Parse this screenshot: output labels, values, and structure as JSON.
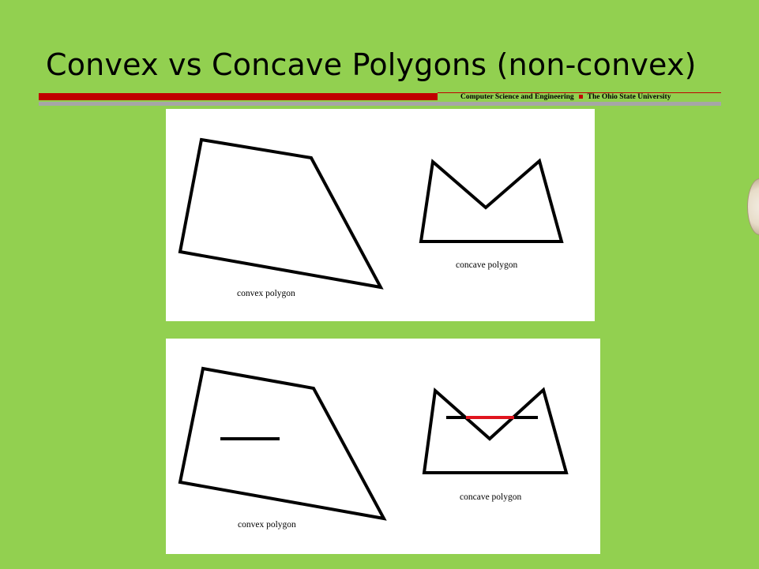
{
  "slide": {
    "title": "Convex vs Concave Polygons (non-convex)",
    "footer": {
      "department": "Computer Science and Engineering",
      "university": "The Ohio State University"
    }
  },
  "panels": [
    {
      "convex_caption": "convex polygon",
      "concave_caption": "concave polygon"
    },
    {
      "convex_caption": "convex polygon",
      "concave_caption": "concave polygon"
    }
  ],
  "colors": {
    "background": "#92d050",
    "accent_red": "#c00000",
    "rule_gray": "#a6a6a6",
    "stroke": "#000000",
    "highlight_segment": "#e0141e"
  },
  "icons": {
    "seal": "ohio-state-seal-icon"
  }
}
